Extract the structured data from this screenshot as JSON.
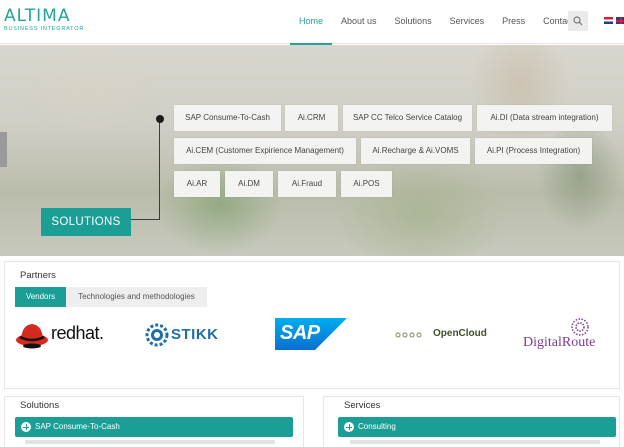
{
  "header": {
    "logo_main": "ALTIMA",
    "logo_sub": "BUSINESS INTEGRATOR",
    "nav": [
      "Home",
      "About us",
      "Solutions",
      "Services",
      "Press",
      "Contact"
    ],
    "active_nav": "Home"
  },
  "hero": {
    "solutions_label": "SOLUTIONS",
    "solution_buttons": [
      "SAP Consume-To-Cash",
      "Ai.CRM",
      "SAP CC Telco Service Catalog",
      "Ai.DI (Data stream integration)",
      "Ai.CEM (Customer Expirience Management)",
      "Ai.Recharge & Ai.VOMS",
      "Ai.PI (Process Integration)",
      "Ai.AR",
      "Ai.DM",
      "Ai.Fraud",
      "Ai.POS"
    ]
  },
  "partners": {
    "title": "Partners",
    "tabs": [
      "Vendors",
      "Technologies and methodologies"
    ],
    "logos": {
      "redhat": "redhat.",
      "stikk": "STIKK",
      "sap": "SAP",
      "opencloud": "OpenCloud",
      "digitalroute": "DigitalRoute"
    }
  },
  "solutions_panel": {
    "title": "Solutions",
    "item": "SAP Consume-To-Cash"
  },
  "services_panel": {
    "title": "Services",
    "item": "Consulting"
  },
  "colors": {
    "accent": "#1b9e96",
    "logo": "#1fa59b",
    "sap_blue": "#0a6ed1",
    "redhat_red": "#d52b1e",
    "digitalroute_purple": "#7a3c8e"
  }
}
